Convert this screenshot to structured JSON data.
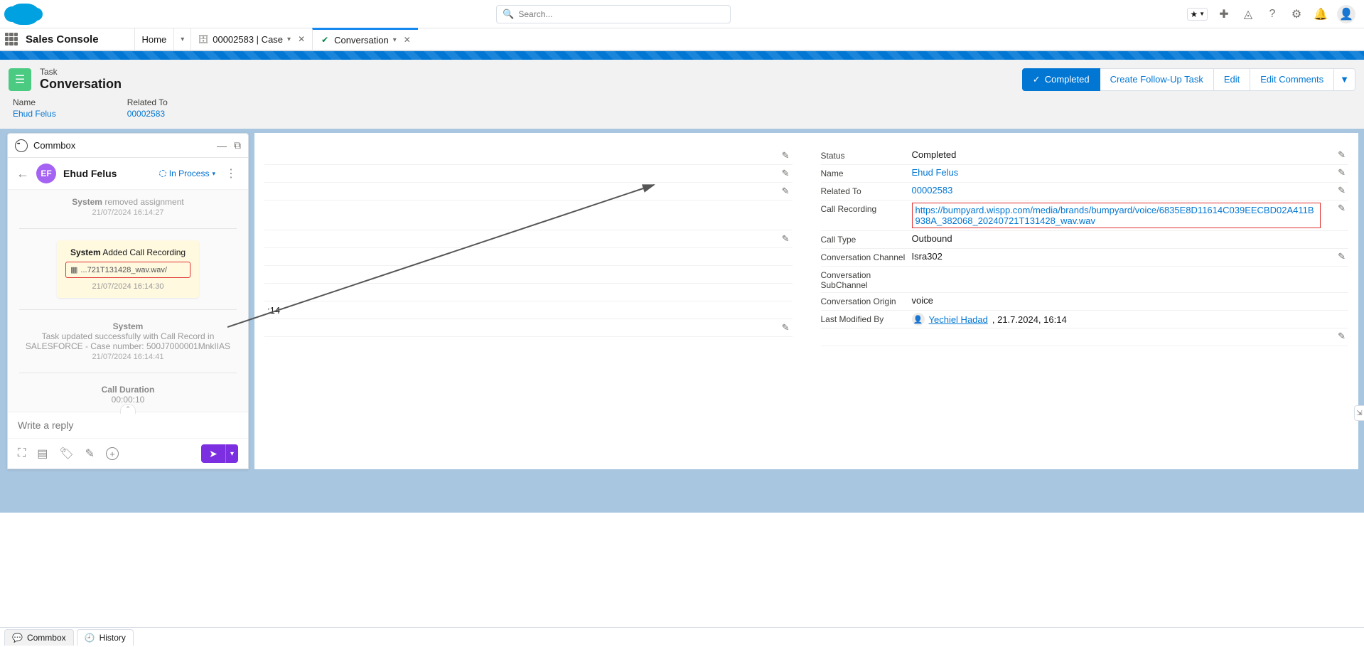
{
  "header": {
    "search_placeholder": "Search..."
  },
  "appNav": {
    "appName": "Sales Console",
    "tabs": [
      {
        "label": "Home"
      },
      {
        "label": "00002583 | Case"
      },
      {
        "label": "Conversation"
      }
    ]
  },
  "record": {
    "type": "Task",
    "title": "Conversation",
    "actions": {
      "completed": "Completed",
      "followup": "Create Follow-Up Task",
      "edit": "Edit",
      "editComments": "Edit Comments"
    },
    "fields": {
      "name_label": "Name",
      "name_value": "Ehud Felus",
      "related_label": "Related To",
      "related_value": "00002583"
    }
  },
  "commbox": {
    "panelTitle": "Commbox",
    "avatar": "EF",
    "name": "Ehud Felus",
    "status": "In Process",
    "events": {
      "e1_label": "System",
      "e1_text": "removed assignment",
      "e1_ts": "21/07/2024 16:14:27",
      "e2_label": "System",
      "e2_text": "Added Call Recording",
      "e2_file": "...721T131428_wav.wav/",
      "e2_ts": "21/07/2024 16:14:30",
      "e3_label": "System",
      "e3_text": "Task updated successfully with Call Record in SALESFORCE - Case number: 500J7000001MnkIIAS",
      "e3_ts": "21/07/2024 16:14:41",
      "e4_label": "Call Duration",
      "e4_text": "00:00:10"
    },
    "reply_placeholder": "Write a reply",
    "timecode_visible": ":14"
  },
  "details": {
    "status_label": "Status",
    "status_value": "Completed",
    "name_label": "Name",
    "name_value": "Ehud Felus",
    "related_label": "Related To",
    "related_value": "00002583",
    "recording_label": "Call Recording",
    "recording_value": "https://bumpyard.wispp.com/media/brands/bumpyard/voice/6835E8D11614C039EECBD02A411B938A_382068_20240721T131428_wav.wav",
    "calltype_label": "Call Type",
    "calltype_value": "Outbound",
    "channel_label": "Conversation Channel",
    "channel_value": "Isra302",
    "subchannel_label": "Conversation SubChannel",
    "subchannel_value": "",
    "origin_label": "Conversation Origin",
    "origin_value": "voice",
    "modified_label": "Last Modified By",
    "modified_user": "Yechiel Hadad",
    "modified_ts": ", 21.7.2024, 16:14"
  },
  "footer": {
    "commbox": "Commbox",
    "history": "History"
  }
}
